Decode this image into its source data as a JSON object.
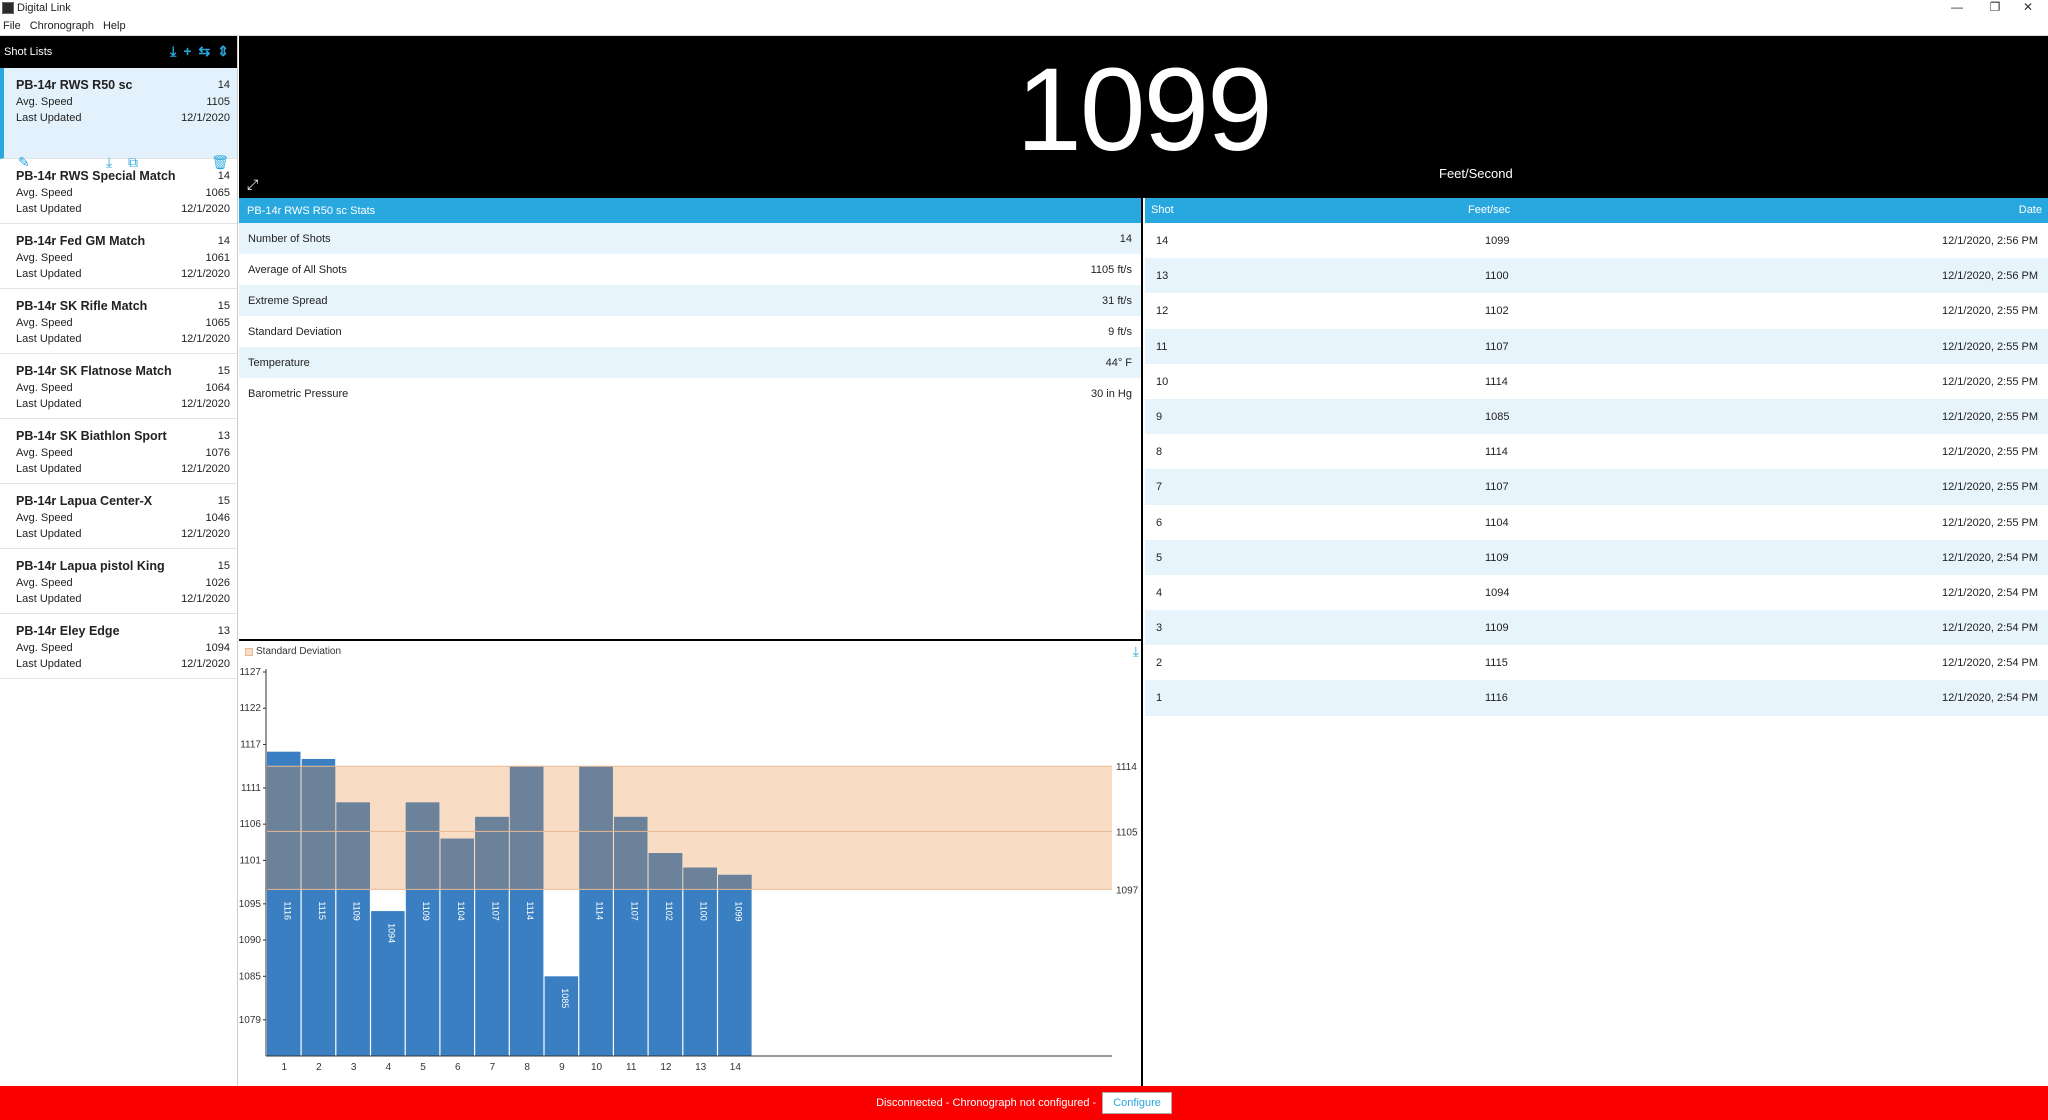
{
  "window": {
    "title": "Digital Link"
  },
  "menu": [
    "File",
    "Chronograph",
    "Help"
  ],
  "sidebar": {
    "title": "Shot Lists",
    "avg_label": "Avg. Speed",
    "updated_label": "Last Updated",
    "items": [
      {
        "name": "PB-14r RWS R50 sc",
        "count": "14",
        "avg": "1105",
        "updated": "12/1/2020"
      },
      {
        "name": "PB-14r RWS Special Match",
        "count": "14",
        "avg": "1065",
        "updated": "12/1/2020"
      },
      {
        "name": "PB-14r Fed GM Match",
        "count": "14",
        "avg": "1061",
        "updated": "12/1/2020"
      },
      {
        "name": "PB-14r SK Rifle Match",
        "count": "15",
        "avg": "1065",
        "updated": "12/1/2020"
      },
      {
        "name": "PB-14r SK Flatnose Match",
        "count": "15",
        "avg": "1064",
        "updated": "12/1/2020"
      },
      {
        "name": "PB-14r SK Biathlon Sport",
        "count": "13",
        "avg": "1076",
        "updated": "12/1/2020"
      },
      {
        "name": "PB-14r Lapua Center-X",
        "count": "15",
        "avg": "1046",
        "updated": "12/1/2020"
      },
      {
        "name": "PB-14r Lapua pistol King",
        "count": "15",
        "avg": "1026",
        "updated": "12/1/2020"
      },
      {
        "name": "PB-14r Eley Edge",
        "count": "13",
        "avg": "1094",
        "updated": "12/1/2020"
      }
    ]
  },
  "display": {
    "speed": "1099",
    "unit": "Feet/Second"
  },
  "stats": {
    "title": "PB-14r RWS R50 sc Stats",
    "rows": [
      {
        "label": "Number of Shots",
        "value": "14"
      },
      {
        "label": "Average of All Shots",
        "value": "1105 ft/s"
      },
      {
        "label": "Extreme Spread",
        "value": "31 ft/s"
      },
      {
        "label": "Standard Deviation",
        "value": "9 ft/s"
      },
      {
        "label": "Temperature",
        "value": "44° F"
      },
      {
        "label": "Barometric Pressure",
        "value": "30 in Hg"
      }
    ]
  },
  "shots": {
    "headers": {
      "shot": "Shot",
      "speed": "Feet/sec",
      "date": "Date"
    },
    "rows": [
      {
        "shot": "14",
        "speed": "1099",
        "date": "12/1/2020, 2:56 PM"
      },
      {
        "shot": "13",
        "speed": "1100",
        "date": "12/1/2020, 2:56 PM"
      },
      {
        "shot": "12",
        "speed": "1102",
        "date": "12/1/2020, 2:55 PM"
      },
      {
        "shot": "11",
        "speed": "1107",
        "date": "12/1/2020, 2:55 PM"
      },
      {
        "shot": "10",
        "speed": "1114",
        "date": "12/1/2020, 2:55 PM"
      },
      {
        "shot": "9",
        "speed": "1085",
        "date": "12/1/2020, 2:55 PM"
      },
      {
        "shot": "8",
        "speed": "1114",
        "date": "12/1/2020, 2:55 PM"
      },
      {
        "shot": "7",
        "speed": "1107",
        "date": "12/1/2020, 2:55 PM"
      },
      {
        "shot": "6",
        "speed": "1104",
        "date": "12/1/2020, 2:55 PM"
      },
      {
        "shot": "5",
        "speed": "1109",
        "date": "12/1/2020, 2:54 PM"
      },
      {
        "shot": "4",
        "speed": "1094",
        "date": "12/1/2020, 2:54 PM"
      },
      {
        "shot": "3",
        "speed": "1109",
        "date": "12/1/2020, 2:54 PM"
      },
      {
        "shot": "2",
        "speed": "1115",
        "date": "12/1/2020, 2:54 PM"
      },
      {
        "shot": "1",
        "speed": "1116",
        "date": "12/1/2020, 2:54 PM"
      }
    ]
  },
  "chart_data": {
    "type": "bar",
    "legend": "Standard Deviation",
    "categories": [
      "1",
      "2",
      "3",
      "4",
      "5",
      "6",
      "7",
      "8",
      "9",
      "10",
      "11",
      "12",
      "13",
      "14"
    ],
    "values": [
      1116,
      1115,
      1109,
      1094,
      1109,
      1104,
      1107,
      1114,
      1085,
      1114,
      1107,
      1102,
      1100,
      1099
    ],
    "ylim": [
      1074,
      1127
    ],
    "yticks": [
      1127,
      1122,
      1117,
      1111,
      1106,
      1101,
      1095,
      1090,
      1085,
      1079
    ],
    "band": {
      "low": 1097,
      "mid": 1105,
      "high": 1114
    },
    "colors": {
      "bar": "#3a7fc1",
      "band": "#f8dcc4"
    }
  },
  "status": {
    "text": "Disconnected - Chronograph not configured -",
    "button": "Configure"
  },
  "colors": {
    "accent": "#29a8e0",
    "status_bar": "#fa0000"
  }
}
